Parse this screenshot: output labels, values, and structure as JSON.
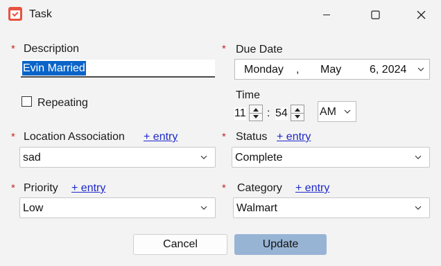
{
  "window": {
    "title": "Task",
    "icon": "task-calendar-icon",
    "controls": [
      "minimize-icon",
      "maximize-icon",
      "close-icon"
    ]
  },
  "form": {
    "required_mark": "*",
    "description": {
      "label": "Description",
      "value": "Evin Married"
    },
    "due_date": {
      "label": "Due Date",
      "weekday": "Monday",
      "sep": ",",
      "month": "May",
      "day_year": "6, 2024"
    },
    "repeating": {
      "label": "Repeating",
      "checked": false
    },
    "time": {
      "label": "Time",
      "hour": "11",
      "colon": ":",
      "minute": "54",
      "ampm": "AM"
    },
    "location": {
      "label": "Location Association",
      "link": "+ entry",
      "value": "sad"
    },
    "status": {
      "label": "Status",
      "link": "+ entry",
      "value": "Complete"
    },
    "priority": {
      "label": "Priority",
      "link": "+ entry",
      "value": "Low"
    },
    "category": {
      "label": "Category",
      "link": "+ entry",
      "value": "Walmart"
    }
  },
  "buttons": {
    "cancel": "Cancel",
    "update": "Update"
  },
  "colors": {
    "required": "#c62828",
    "link": "#1d27c9",
    "selection": "#0a64c8",
    "update_button": "#98b4d4",
    "app_icon": "#e8533f"
  }
}
